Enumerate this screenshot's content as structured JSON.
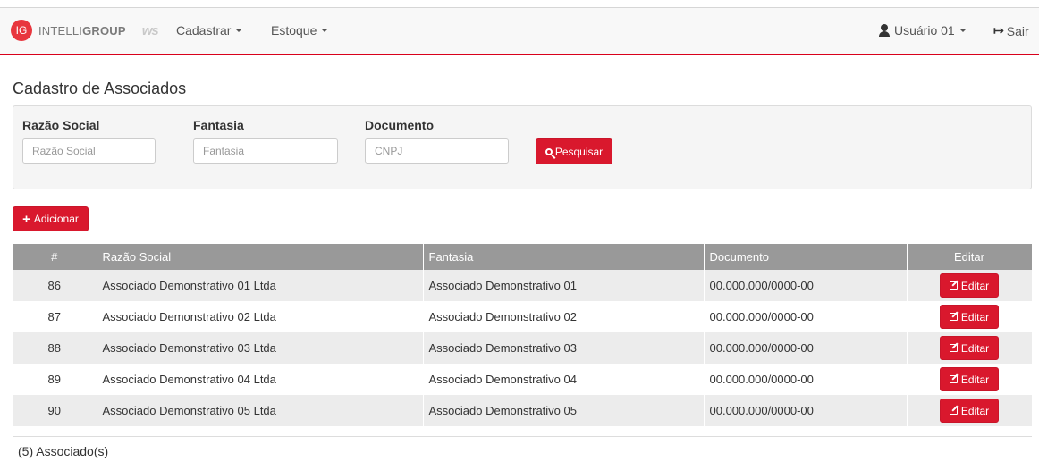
{
  "navbar": {
    "logo_badge": "IG",
    "brand_light": "INTELLI",
    "brand_bold": "GROUP",
    "partner_mark": "ws",
    "menu": [
      {
        "label": "Cadastrar",
        "icon": "caret-down-icon"
      },
      {
        "label": "Estoque",
        "icon": "caret-down-icon"
      }
    ],
    "user_label": "Usuário 01",
    "user_icon": "user-icon",
    "signout_label": "Sair",
    "signout_icon": "sign-out-icon",
    "accent_color": "#d9001b"
  },
  "page": {
    "title": "Cadastro de Associados"
  },
  "filters": {
    "razao_social": {
      "label": "Razão Social",
      "placeholder": "Razão Social",
      "value": ""
    },
    "fantasia": {
      "label": "Fantasia",
      "placeholder": "Fantasia",
      "value": ""
    },
    "documento": {
      "label": "Documento",
      "placeholder": "CNPJ",
      "value": ""
    },
    "search_button": {
      "label": "Pesquisar",
      "icon": "search-icon"
    }
  },
  "actions": {
    "add_button": {
      "label": "Adicionar",
      "icon": "plus-icon"
    }
  },
  "table": {
    "headers": {
      "num": "#",
      "razao": "Razão Social",
      "fantasia": "Fantasia",
      "documento": "Documento",
      "editar": "Editar"
    },
    "edit_label": "Editar",
    "edit_icon": "edit-icon",
    "rows": [
      {
        "num": "86",
        "razao": "Associado Demonstrativo 01 Ltda",
        "fantasia": "Associado Demonstrativo 01",
        "documento": "00.000.000/0000-00"
      },
      {
        "num": "87",
        "razao": "Associado Demonstrativo 02 Ltda",
        "fantasia": "Associado Demonstrativo 02",
        "documento": "00.000.000/0000-00"
      },
      {
        "num": "88",
        "razao": "Associado Demonstrativo 03 Ltda",
        "fantasia": "Associado Demonstrativo 03",
        "documento": "00.000.000/0000-00"
      },
      {
        "num": "89",
        "razao": "Associado Demonstrativo 04 Ltda",
        "fantasia": "Associado Demonstrativo 04",
        "documento": "00.000.000/0000-00"
      },
      {
        "num": "90",
        "razao": "Associado Demonstrativo 05 Ltda",
        "fantasia": "Associado Demonstrativo 05",
        "documento": "00.000.000/0000-00"
      }
    ]
  },
  "footer": {
    "count_label": "(5) Associado(s)"
  },
  "colors": {
    "primary_red": "#d9182d",
    "header_gray": "#999999",
    "row_stripe": "#ececec"
  }
}
